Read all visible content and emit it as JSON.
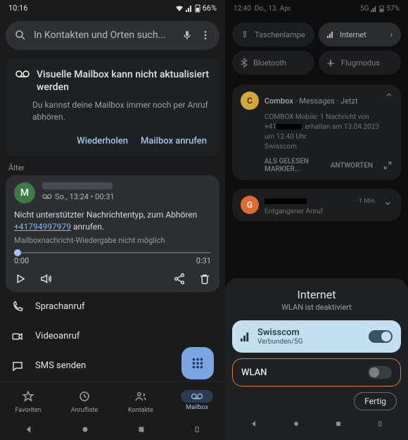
{
  "left": {
    "status": {
      "time": "10:16",
      "battery": "66%"
    },
    "search": {
      "placeholder": "In Kontakten und Orten such..."
    },
    "vvm": {
      "title": "Visuelle Mailbox kann nicht aktualisiert werden",
      "body": "Du kannst deine Mailbox immer noch per Anruf abhören.",
      "retry": "Wiederholen",
      "call": "Mailbox anrufen"
    },
    "older": "Älter",
    "msg": {
      "avatar": "M",
      "meta": "So., 13:24 • 00:31",
      "text_pre": "Nicht unterstützter Nachrichtentyp, zum Abhören ",
      "phone": "+41794997979",
      "text_post": " anrufen.",
      "sub": "Mailboxnachricht-Wiedergabe nicht möglich",
      "t0": "0:00",
      "t1": "0:31"
    },
    "actions": {
      "call": "Sprachanruf",
      "video": "Videoanruf",
      "sms": "SMS senden"
    },
    "nav": {
      "fav": "Favoriten",
      "log": "Anrufliste",
      "contacts": "Kontakte",
      "mailbox": "Mailbox"
    }
  },
  "right": {
    "status": {
      "time": "12:40",
      "date": "Do., 13. Apr.",
      "net": "5G",
      "battery": "57%"
    },
    "qs": {
      "torch": "Taschenlampe",
      "internet": "Internet",
      "bt": "Bluetooth",
      "flight": "Flugmodus"
    },
    "notif1": {
      "avatar": "C",
      "app": "Combox",
      "via": "Messages",
      "when": "Jetzt",
      "l1": "COMBOX Mobile: 1 Nachricht von",
      "l2a": "+41",
      "l2b": ", erhalten am 13.04.2023",
      "l3": "um 12.40 Uhr.",
      "l4": "Swisscom",
      "a1": "ALS GELESEN MARKIER...",
      "a2": "ANTWORTEN"
    },
    "notif2": {
      "avatar": "G",
      "title": "Entgangener Anruf",
      "when": "1 Min."
    },
    "sheet": {
      "title": "Internet",
      "sub": "WLAN ist deaktiviert",
      "carrier": "Swisscom",
      "carrier_sub": "Verbunden/5G",
      "wlan": "WLAN",
      "done": "Fertig"
    }
  }
}
